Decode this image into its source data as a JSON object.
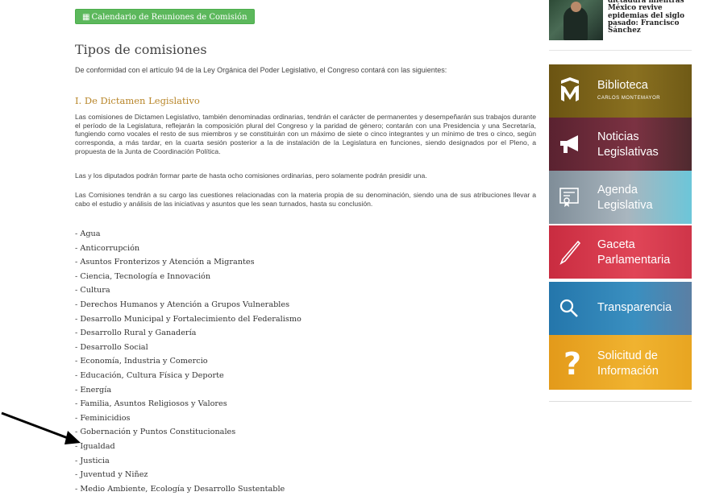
{
  "calendar_button": {
    "label": "Calendario de Reuniones de Comisión",
    "icon": "calendar-icon"
  },
  "page": {
    "title": "Tipos de comisiones",
    "intro": "De conformidad con el artículo 94 de la Ley Orgánica del Poder Legislativo, el Congreso contará con las siguientes:",
    "section_title": "I. De Dictamen Legislativo",
    "paragraph1": "Las comisiones de Dictamen Legislativo, también denominadas ordinarias, tendrán el carácter de permanentes y desempeñarán sus trabajos durante el período de la Legislatura, reflejarán la composición plural del Congreso y la paridad de género; contarán con una Presidencia y una Secretaría, fungiendo como vocales el resto de sus miembros y se constituirán con un máximo de siete o cinco integrantes y un mínimo de tres o cinco, según corresponda, a más tardar, en la cuarta sesión posterior a la de instalación de la Legislatura en funciones, siendo designados por el Pleno, a propuesta de la Junta de Coordinación Política.",
    "paragraph2": "Las y los diputados podrán formar parte de hasta ocho comisiones ordinarias, pero solamente podrán presidir una.",
    "paragraph3": "Las Comisiones tendrán a su cargo las cuestiones relacionadas con la materia propia de su denominación, siendo una de sus atribuciones llevar a cabo el estudio y análisis de las iniciativas y asuntos que les sean turnados, hasta su conclusión."
  },
  "commissions": [
    "- Agua",
    "- Anticorrupción",
    "- Asuntos Fronterizos y Atención a Migrantes",
    "- Ciencia, Tecnología e Innovación",
    "- Cultura",
    "- Derechos Humanos y Atención a Grupos Vulnerables",
    "- Desarrollo Municipal y Fortalecimiento del Federalismo",
    "- Desarrollo Rural y Ganadería",
    "- Desarrollo Social",
    "- Economía, Industria y Comercio",
    "- Educación, Cultura Física y Deporte",
    "- Energía",
    "- Familia, Asuntos Religiosos y Valores",
    "- Feminicidios",
    "- Gobernación y Puntos Constitucionales",
    "- Igualdad",
    "- Justicia",
    "- Juventud y Niñez",
    "- Medio Ambiente, Ecología y Desarrollo Sustentable"
  ],
  "news": {
    "text": "dictadura mientras México revive epidemias del siglo pasado: Francisco Sánchez"
  },
  "sidebar": [
    {
      "line1": "Biblioteca",
      "line2": "",
      "sub": "CARLOS MONTEMAYOR",
      "icon": "library-icon",
      "color": "#7a6418"
    },
    {
      "line1": "Noticias",
      "line2": "Legislativas",
      "sub": "",
      "icon": "megaphone-icon",
      "color": "#6b2a35"
    },
    {
      "line1": "Agenda",
      "line2": "Legislativa",
      "sub": "",
      "icon": "agenda-icon",
      "color": "#8a9aa6"
    },
    {
      "line1": "Gaceta",
      "line2": "Parlamentaria",
      "sub": "",
      "icon": "pen-icon",
      "color": "#d23b4d"
    },
    {
      "line1": "Transparencia",
      "line2": "",
      "sub": "",
      "icon": "search-icon",
      "color": "#2c78a8"
    },
    {
      "line1": "Solicitud de",
      "line2": "Información",
      "sub": "",
      "icon": "question-icon",
      "color": "#e5a422"
    }
  ]
}
